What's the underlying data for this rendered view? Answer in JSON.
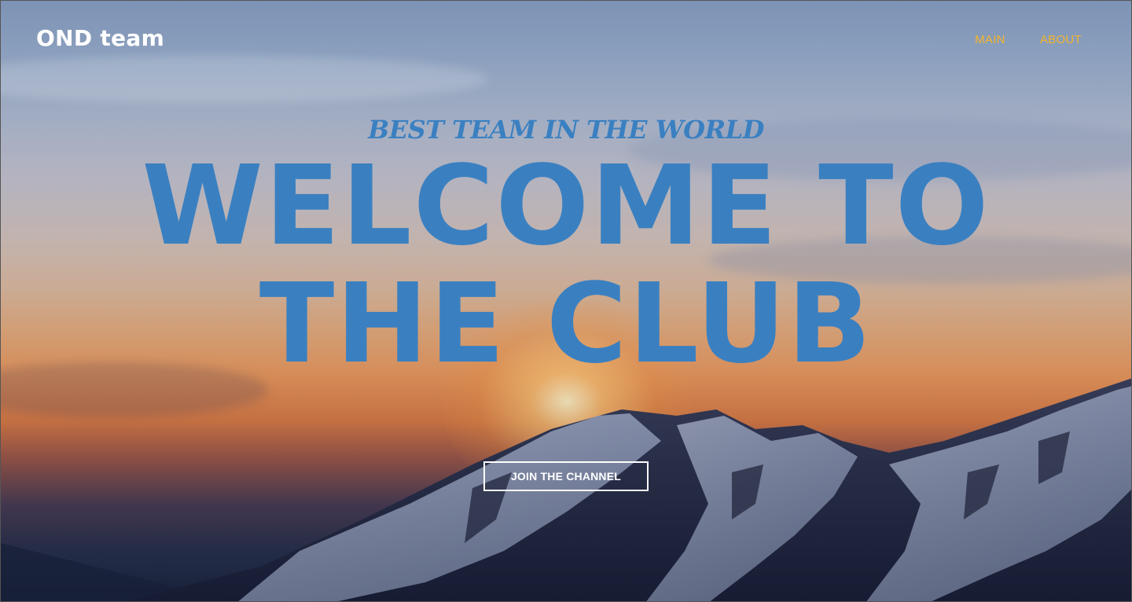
{
  "header": {
    "brand": "OND team",
    "nav": [
      {
        "label": "MAIN"
      },
      {
        "label": "ABOUT"
      }
    ]
  },
  "hero": {
    "tagline": "BEST TEAM IN THE WORLD",
    "headline_line1": "WELCOME TO",
    "headline_line2": "THE CLUB",
    "cta_label": "JOIN THE CHANNEL"
  },
  "colors": {
    "accent_blue": "#3a80c1",
    "nav_gold": "#f2b52c",
    "white": "#ffffff"
  }
}
